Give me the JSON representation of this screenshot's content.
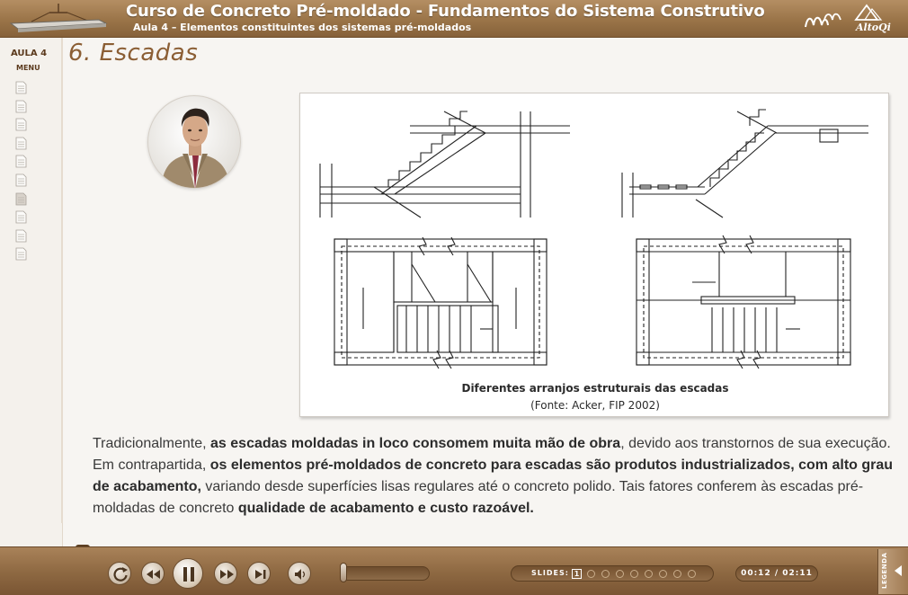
{
  "header": {
    "title": "Curso de Concreto Pré-moldado - Fundamentos do Sistema Construtivo",
    "subtitle": "Aula 4 – Elementos constituintes dos sistemas pré-moldados",
    "logo_text": "AltoQi"
  },
  "sidebar": {
    "aula_label": "AULA 4",
    "menu_label": "MENU",
    "page_count": 10,
    "current_page_index": 6
  },
  "main": {
    "section_title": "6. Escadas",
    "figure": {
      "caption_title": "Diferentes arranjos estruturais das escadas",
      "caption_source": "(Fonte: Acker, FIP 2002)"
    },
    "paragraph": {
      "p1": "Tradicionalmente, ",
      "b1": "as escadas moldadas in loco consomem muita mão de obra",
      "p2": ", devido aos transtornos de sua execução. Em contrapartida, ",
      "b2": "os elementos pré-moldados de concreto para escadas são produtos industrializados, com alto grau de acabamento,",
      "p3": " variando desde superfícies lisas regulares até o concreto polido. Tais fatores conferem às escadas pré-moldadas de concreto ",
      "b3": "qualidade de acabamento e custo razoável."
    }
  },
  "footer": {
    "slides_label": "SLIDES:",
    "current_slide": "1",
    "slide_total_dots": 9,
    "time": "00:12 / 02:11",
    "legend_label": "LEGENDA",
    "volume_level": 0.0
  },
  "colors": {
    "brand_brown": "#9a7448",
    "title_brown": "#8b5e34"
  }
}
